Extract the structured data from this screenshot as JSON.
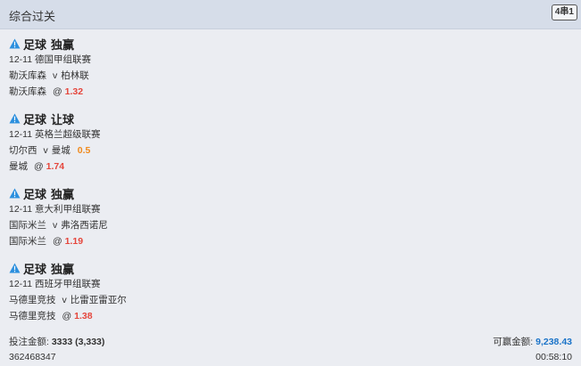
{
  "header": {
    "title": "综合过关",
    "parlay_badge": "4串1"
  },
  "bets": [
    {
      "sport": "足球",
      "market": "独赢",
      "date_league": "12-11 德国甲组联赛",
      "home": "勒沃库森",
      "vs": "v",
      "away": "柏林联",
      "handicap": "",
      "selection": "勒沃库森",
      "at": "@",
      "odds": "1.32"
    },
    {
      "sport": "足球",
      "market": "让球",
      "date_league": "12-11 英格兰超级联赛",
      "home": "切尔西",
      "vs": "v",
      "away": "曼城",
      "handicap": "0.5",
      "selection": "曼城",
      "at": "@",
      "odds": "1.74"
    },
    {
      "sport": "足球",
      "market": "独赢",
      "date_league": "12-11 意大利甲组联赛",
      "home": "国际米兰",
      "vs": "v",
      "away": "弗洛西诺尼",
      "handicap": "",
      "selection": "国际米兰",
      "at": "@",
      "odds": "1.19"
    },
    {
      "sport": "足球",
      "market": "独赢",
      "date_league": "12-11 西班牙甲组联赛",
      "home": "马德里竞技",
      "vs": "v",
      "away": "比雷亚雷亚尔",
      "handicap": "",
      "selection": "马德里竞技",
      "at": "@",
      "odds": "1.38"
    }
  ],
  "footer": {
    "stake_label": "投注金额:",
    "stake_value": "3333 (3,333)",
    "win_label": "可赢金额:",
    "win_value": "9,238.43",
    "ticket_id": "362468347",
    "time": "00:58:10"
  },
  "icons": {
    "warning": "warning-triangle-icon"
  },
  "colors": {
    "odds": "#e5463c",
    "handicap": "#f08a1c",
    "win": "#1a73c8",
    "warning": "#2b8fde"
  }
}
